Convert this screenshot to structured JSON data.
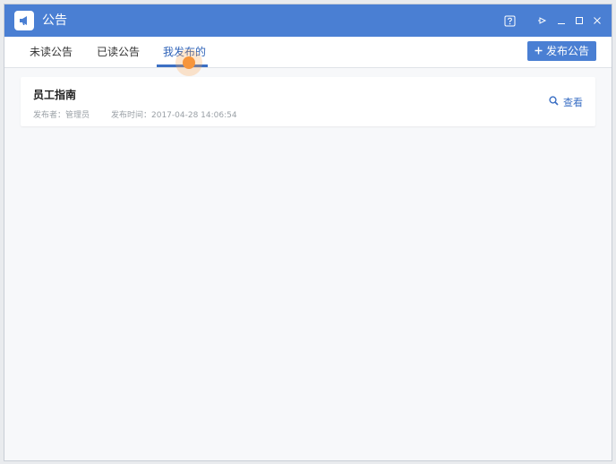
{
  "window": {
    "title": "公告",
    "icons": [
      "megaphone-icon",
      "help-icon",
      "pin-icon",
      "minimize-icon",
      "maximize-icon",
      "close-icon"
    ]
  },
  "tabs": [
    {
      "label": "未读公告",
      "active": false
    },
    {
      "label": "已读公告",
      "active": false
    },
    {
      "label": "我发布的",
      "active": true
    }
  ],
  "toolbar": {
    "publish_label": "发布公告",
    "publish_icon": "plus-icon"
  },
  "announcements": [
    {
      "title": "员工指南",
      "publisher": "发布者：管理员",
      "time": "发布时间：2017-04-28 14:06:54",
      "view_label": "查看",
      "view_icon": "search-icon"
    }
  ],
  "colors": {
    "accent": "#4a7fd3",
    "background": "#f7f8fa"
  }
}
